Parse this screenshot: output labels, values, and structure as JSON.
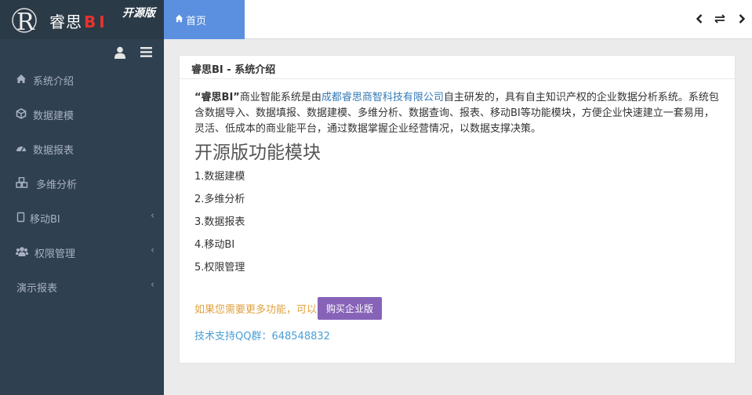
{
  "brand": {
    "name": "睿思",
    "bi": "BI",
    "edition": "开源版",
    "logo_letter": "R"
  },
  "sidebar": {
    "items": [
      {
        "label": "系统介绍",
        "icon": "home-icon",
        "has_children": false
      },
      {
        "label": "数据建模",
        "icon": "cube-icon",
        "has_children": false
      },
      {
        "label": "数据报表",
        "icon": "dashboard-icon",
        "has_children": false
      },
      {
        "label": "多维分析",
        "icon": "cubes-icon",
        "has_children": false
      },
      {
        "label": "移动BI",
        "icon": "tablet-icon",
        "has_children": true
      },
      {
        "label": "权限管理",
        "icon": "users-icon",
        "has_children": true
      },
      {
        "label": "演示报表",
        "icon": "",
        "has_children": true
      }
    ]
  },
  "topbar": {
    "home_tab": "首页"
  },
  "panel": {
    "title": "睿思BI - 系统介绍",
    "intro_quote": "“睿思BI”",
    "intro_a": "商业智能系统是由",
    "intro_link": "成都睿思商智科技有限公司",
    "intro_b": "自主研发的，具有自主知识产权的企业数据分析系统。系统包含数据导入、数据填报、数据建模、多维分析、数据查询、报表、移动BI等功能模块，方便企业快速建立一套易用，灵活、低成本的商业能平台，通过数据掌握企业经营情况，以数据支撑决策。",
    "section_title": "开源版功能模块",
    "modules": [
      "1.数据建模",
      "2.多维分析",
      "3.数据报表",
      "4.移动BI",
      "5.权限管理"
    ],
    "more_text": "如果您需要更多功能，可以",
    "buy_button": "购买企业版",
    "support_text": "技术支持QQ群：648548832"
  },
  "colors": {
    "sidebar_bg": "#2f4050",
    "home_tab": "#5b8fdf",
    "buy_button": "#8763b8",
    "more_text": "#e0a240",
    "support_text": "#4a9fd4",
    "link": "#337ab7"
  }
}
